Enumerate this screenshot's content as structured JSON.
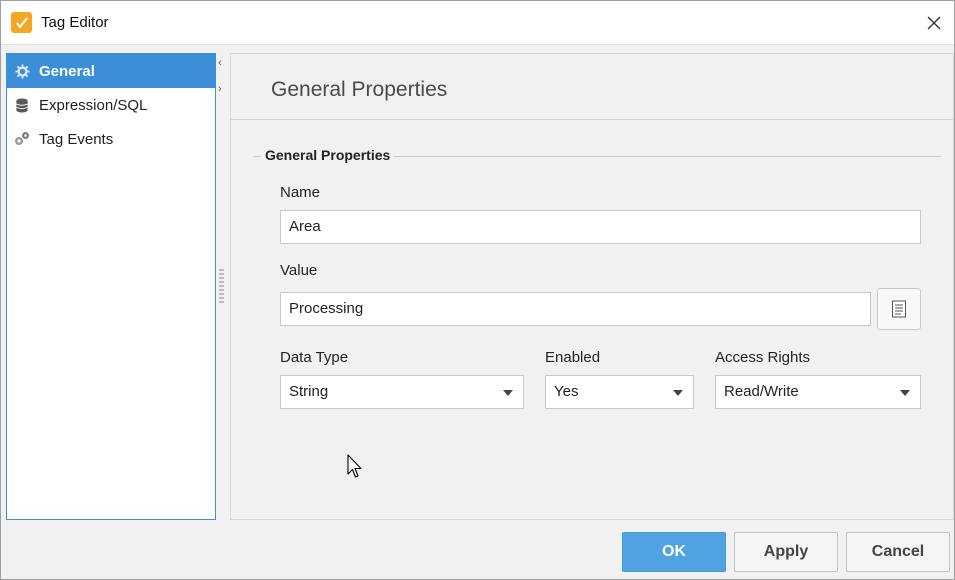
{
  "window": {
    "title": "Tag Editor",
    "app_icon": "ignition-tag-icon",
    "close_icon": "close-icon"
  },
  "sidebar": {
    "items": [
      {
        "label": "General",
        "icon": "gear-icon",
        "active": true
      },
      {
        "label": "Expression/SQL",
        "icon": "database-icon",
        "active": false
      },
      {
        "label": "Tag Events",
        "icon": "events-gears-icon",
        "active": false
      }
    ]
  },
  "main": {
    "header": "General Properties",
    "section_title": "General Properties",
    "name": {
      "label": "Name",
      "value": "Area"
    },
    "value": {
      "label": "Value",
      "value": "Processing"
    },
    "data_type": {
      "label": "Data Type",
      "selected": "String"
    },
    "enabled": {
      "label": "Enabled",
      "selected": "Yes"
    },
    "access_rights": {
      "label": "Access Rights",
      "selected": "Read/Write"
    }
  },
  "footer": {
    "ok_label": "OK",
    "apply_label": "Apply",
    "cancel_label": "Cancel"
  },
  "colors": {
    "accent": "#3b8fd9",
    "ok_button": "#4fa3e0",
    "app_icon": "#f5a623"
  }
}
